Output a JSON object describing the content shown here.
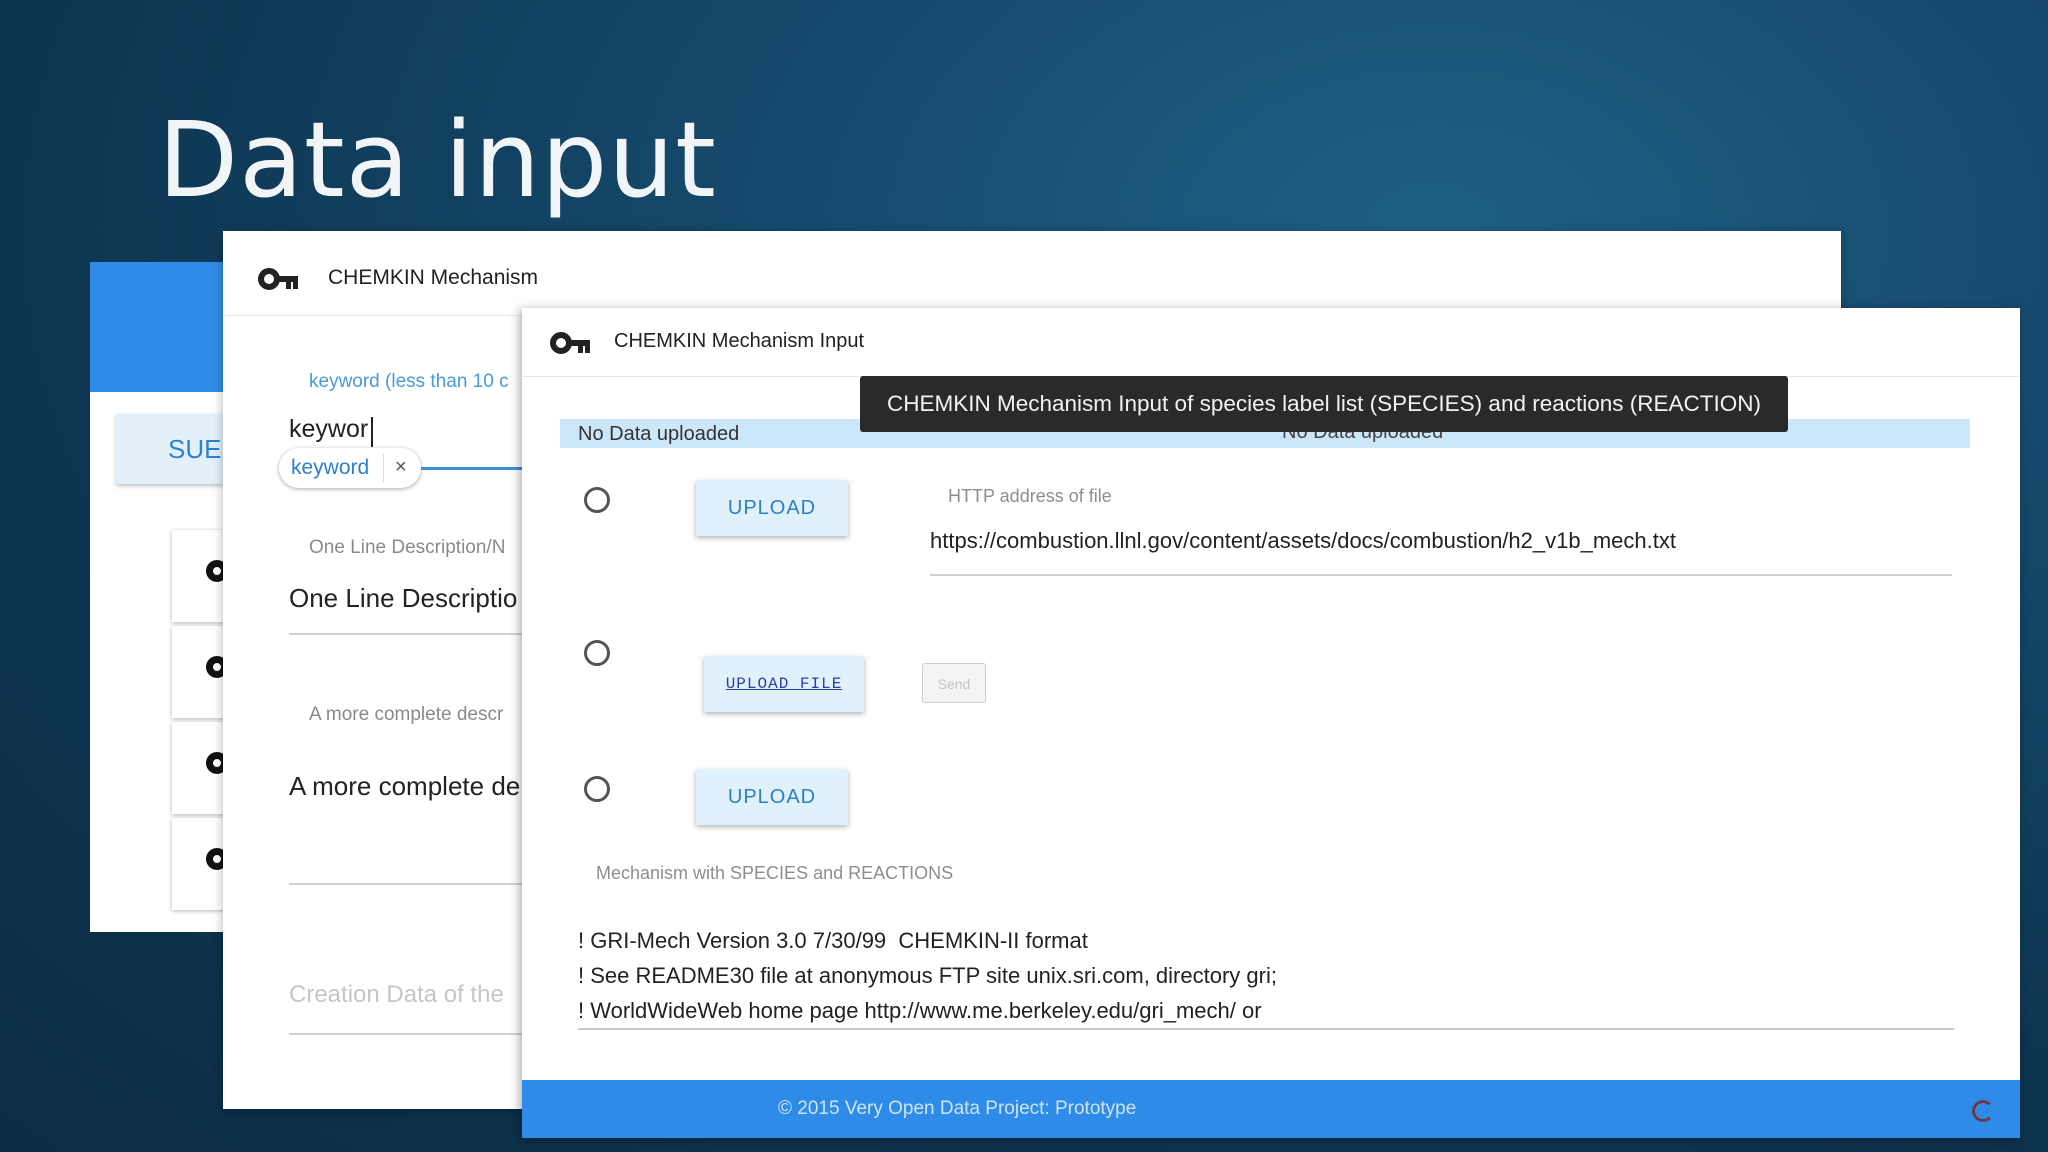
{
  "slide": {
    "title": "Data input"
  },
  "back_window": {
    "submit_label": "SUE"
  },
  "mid_window": {
    "title": "CHEMKIN Mechanism",
    "keyword_label": "keyword (less than 10 c",
    "keyword_value": "keywor",
    "chip_label": "keyword",
    "chip_remove": "×",
    "one_line_label": "One Line Description/N",
    "one_line_value": "One Line Descriptio",
    "complete_label": "A more complete descr",
    "complete_value": "A more complete de",
    "creation_placeholder": "Creation Data of the"
  },
  "front_window": {
    "title": "CHEMKIN Mechanism Input",
    "tooltip": "CHEMKIN Mechanism Input of species label list (SPECIES) and reactions (REACTION)",
    "status_left": "No Data uploaded",
    "status_ghost": "No Data uploaded",
    "upload_button_1": "UPLOAD",
    "http_label": "HTTP address of file",
    "http_value": "https://combustion.llnl.gov/content/assets/docs/combustion/h2_v1b_mech.txt",
    "upload_file_button": "UPLOAD FILE",
    "send_button": "Send",
    "upload_button_2": "UPLOAD",
    "mechanism_label": "Mechanism with SPECIES and REACTIONS",
    "mechanism_lines": [
      "! GRI-Mech Version 3.0 7/30/99  CHEMKIN-II format",
      "! See README30 file at anonymous FTP site unix.sri.com, directory gri;",
      "! WorldWideWeb home page http://www.me.berkeley.edu/gri_mech/ or"
    ],
    "footer_text": "© 2015 Very Open Data Project: Prototype"
  },
  "colors": {
    "accent_blue": "#2e8ce8",
    "status_bar": "#cde7fa",
    "tooltip_bg": "#2a2a2a"
  },
  "icons": [
    "key-icon",
    "radio-button",
    "spinner-icon"
  ]
}
